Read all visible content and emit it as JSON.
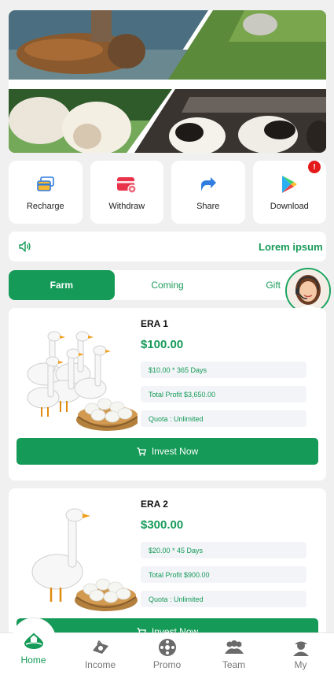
{
  "actions": [
    {
      "label": "Recharge",
      "icon": "card-icon"
    },
    {
      "label": "Withdraw",
      "icon": "wallet-icon"
    },
    {
      "label": "Share",
      "icon": "share-icon"
    },
    {
      "label": "Download",
      "icon": "play-store-icon",
      "badge": "!"
    }
  ],
  "notice": {
    "text": "Lorem ipsum",
    "icon": "speaker-icon"
  },
  "tabs": [
    {
      "label": "Farm",
      "active": true
    },
    {
      "label": "Coming",
      "active": false
    },
    {
      "label": "Gift",
      "active": false
    }
  ],
  "products": [
    {
      "name": "ERA 1",
      "price": "$100.00",
      "daily": "$10.00 * 365 Days",
      "total_profit": "Total Profit $3,650.00",
      "quota": "Quota : Unlimited",
      "button": "Invest Now"
    },
    {
      "name": "ERA 2",
      "price": "$300.00",
      "daily": "$20.00 * 45 Days",
      "total_profit": "Total Profit $900.00",
      "quota": "Quota : Unlimited",
      "button": "Invest Now"
    }
  ],
  "nav": [
    {
      "label": "Home",
      "icon": "home-farm-icon",
      "active": true
    },
    {
      "label": "Income",
      "icon": "income-icon",
      "active": false
    },
    {
      "label": "Promo",
      "icon": "promo-icon",
      "active": false
    },
    {
      "label": "Team",
      "icon": "team-icon",
      "active": false
    },
    {
      "label": "My",
      "icon": "user-icon",
      "active": false
    }
  ],
  "colors": {
    "accent": "#159a57",
    "badge": "#e31a1a",
    "background": "#f0f0f0"
  }
}
